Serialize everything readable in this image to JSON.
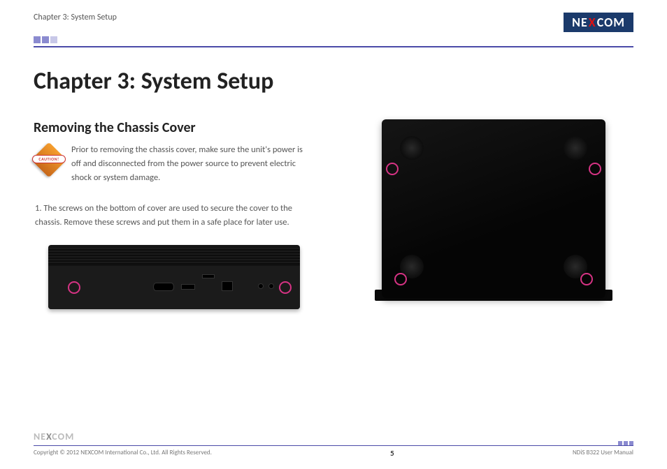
{
  "header": {
    "breadcrumb": "Chapter 3: System Setup",
    "logo_text_pre": "NE",
    "logo_text_x": "X",
    "logo_text_post": "COM"
  },
  "main": {
    "chapter_title": "Chapter 3: System Setup",
    "section_title": "Removing the Chassis Cover",
    "caution_label": "CAUTION!",
    "caution_text": "Prior to removing the chassis cover, make sure the unit's power is off and disconnected from the power source to prevent electric shock or system damage.",
    "step_1": "1. The screws on the bottom of cover are used to secure the cover to the chassis. Remove these screws and put them in a safe place for later use."
  },
  "footer": {
    "logo_text_pre": "NE",
    "logo_text_x": "X",
    "logo_text_post": "COM",
    "copyright": "Copyright © 2012 NEXCOM International Co., Ltd. All Rights Reserved.",
    "page_number": "5",
    "manual_ref": "NDiS B322 User Manual"
  }
}
